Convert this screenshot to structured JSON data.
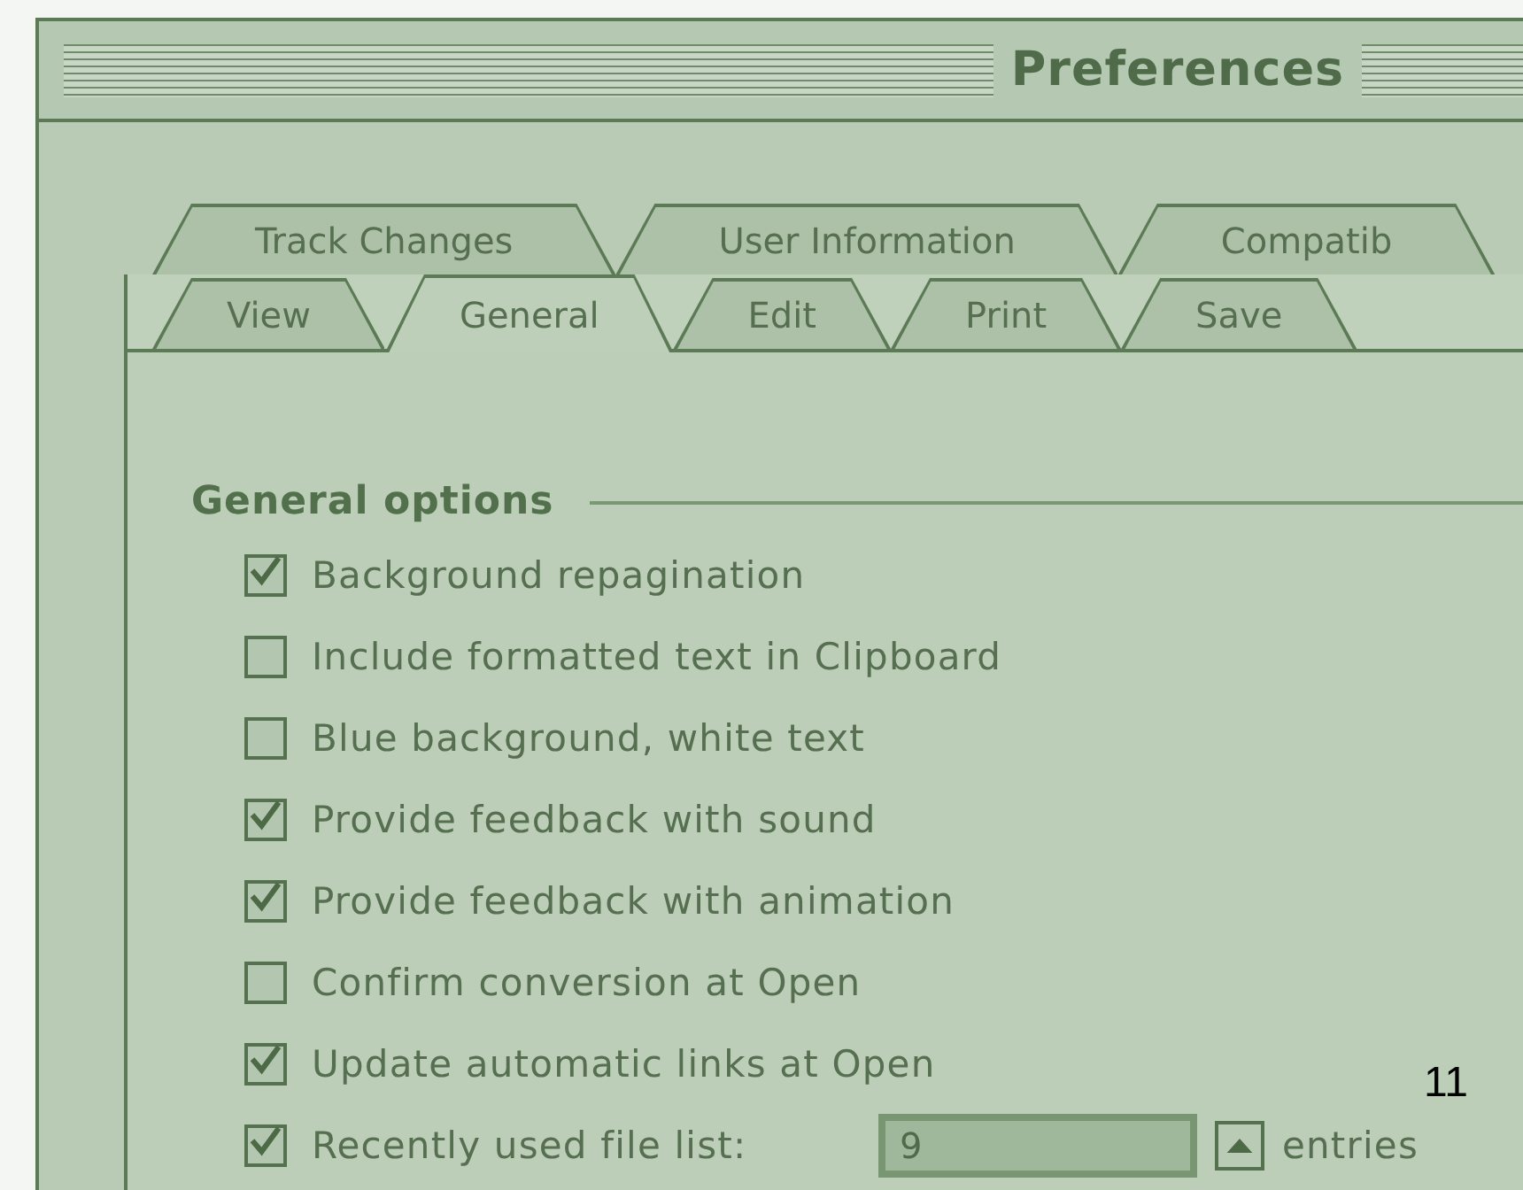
{
  "window": {
    "title": "Preferences"
  },
  "tabs_back": [
    {
      "label": "Track Changes",
      "selected": false
    },
    {
      "label": "User Information",
      "selected": false
    },
    {
      "label": "Compatib",
      "selected": false
    }
  ],
  "tabs_front": [
    {
      "label": "View",
      "selected": false
    },
    {
      "label": "General",
      "selected": true
    },
    {
      "label": "Edit",
      "selected": false
    },
    {
      "label": "Print",
      "selected": false
    },
    {
      "label": "Save",
      "selected": false
    }
  ],
  "section": {
    "title": "General options"
  },
  "options": [
    {
      "label": "Background repagination",
      "checked": true
    },
    {
      "label": "Include formatted text in Clipboard",
      "checked": false
    },
    {
      "label": "Blue background, white text",
      "checked": false
    },
    {
      "label": "Provide feedback with sound",
      "checked": true
    },
    {
      "label": "Provide feedback with animation",
      "checked": true
    },
    {
      "label": "Confirm conversion at Open",
      "checked": false
    },
    {
      "label": "Update automatic links at Open",
      "checked": true
    }
  ],
  "recent_files": {
    "label": "Recently used file list:",
    "checked": true,
    "value": "9",
    "unit": "entries"
  },
  "page_number": "11"
}
